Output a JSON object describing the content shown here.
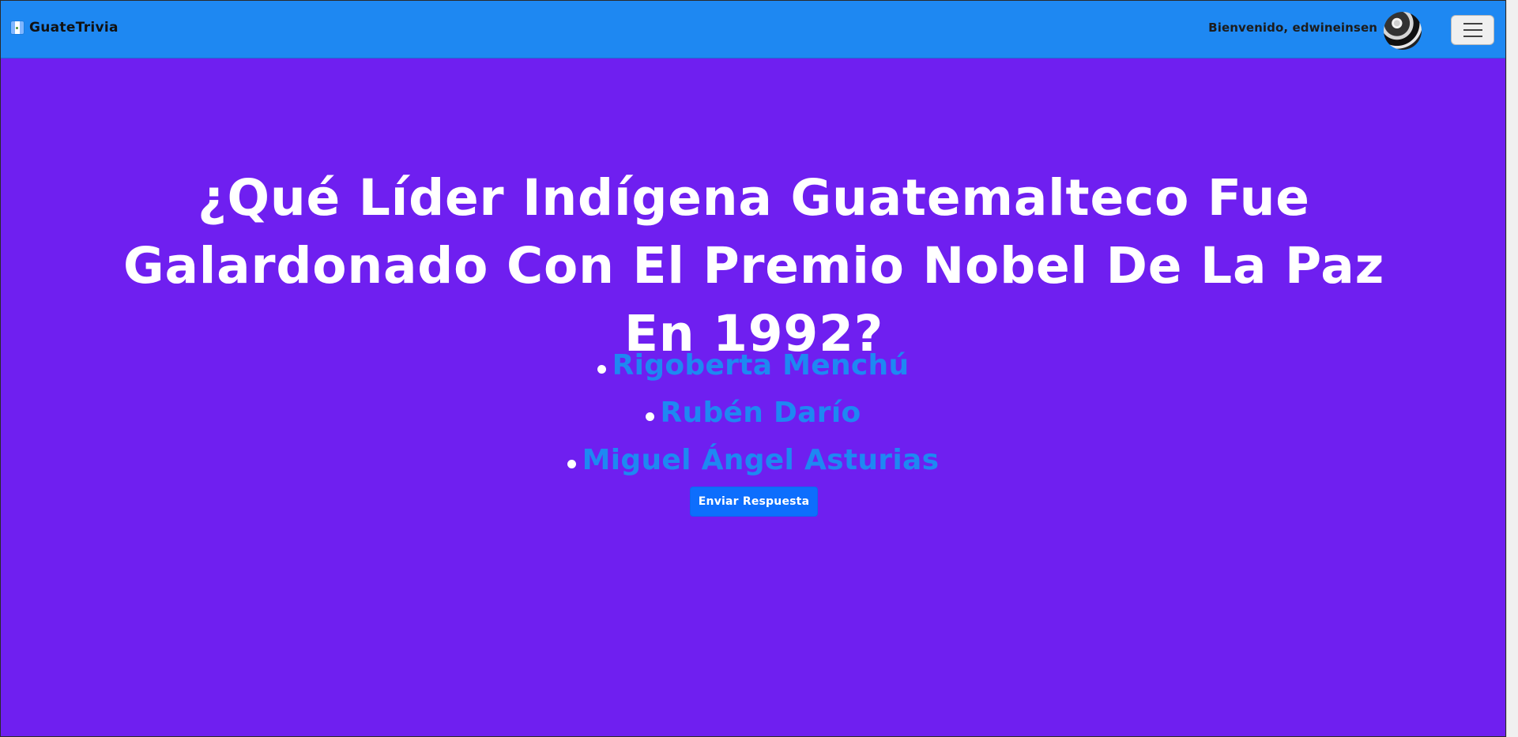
{
  "app": {
    "brand_name": "GuateTrivia",
    "brand_icon": "guatemala-flag-icon"
  },
  "user": {
    "welcome_text": "Bienvenido, edwineinsen",
    "avatar_icon": "user-avatar"
  },
  "navbar": {
    "menu_icon": "hamburger-menu-icon"
  },
  "quiz": {
    "question": "¿Qué líder indígena guatemalteco fue galardonado con el Premio Nobel de la Paz en 1992?",
    "answers": [
      "Rigoberta Menchú",
      "Rubén Darío",
      "Miguel Ángel Asturias"
    ],
    "submit_label": "Enviar Respuesta"
  },
  "colors": {
    "navbar": "#1e88f2",
    "page_background": "#6f1ff0",
    "question_text": "#ffffff",
    "answer_text": "#1e88f2",
    "button": "#0d6efd"
  }
}
